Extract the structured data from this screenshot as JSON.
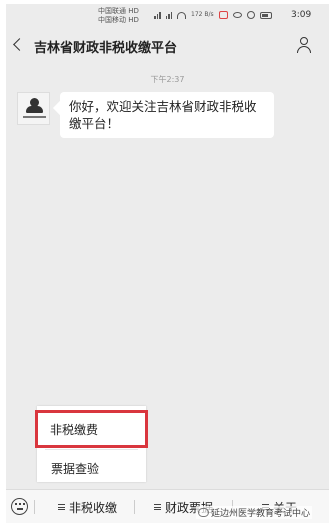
{
  "status_bar": {
    "carrier_1": "中国联通 HD",
    "carrier_2": "中国移动 HD",
    "speed": "172 B/s",
    "time": "3:09"
  },
  "header": {
    "title": "吉林省财政非税收缴平台"
  },
  "chat": {
    "timestamp": "下午2:37",
    "message": "你好，欢迎关注吉林省财政非税收缴平台！"
  },
  "popup_menu": {
    "items": [
      "非税缴费",
      "票据查验"
    ]
  },
  "bottom_bar": {
    "tabs": [
      "非税收缴",
      "财政票据",
      "关于"
    ]
  },
  "watermark": {
    "text": "延边州医学教育考试中心"
  },
  "colors": {
    "highlight": "#d9363e",
    "background": "#ececec"
  }
}
